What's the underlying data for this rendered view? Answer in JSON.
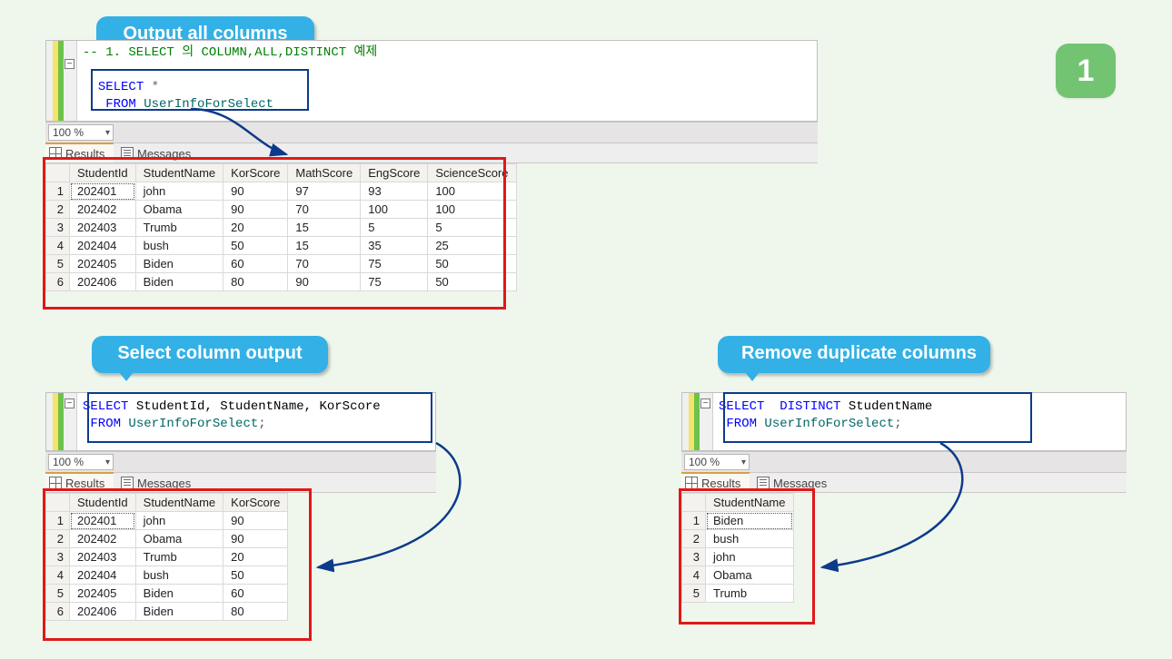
{
  "page_number": "1",
  "callouts": {
    "top": "Output all columns",
    "left": "Select column output",
    "right": "Remove duplicate columns"
  },
  "editor_top": {
    "comment": "-- 1. SELECT 의 COLUMN,ALL,DISTINCT 예제",
    "sql_kw1": "SELECT",
    "sql_star": "*",
    "sql_kw2": "FROM",
    "sql_tbl": "UserInfoForSelect"
  },
  "editor_left": {
    "sql_kw1": "SELECT",
    "sql_cols": "StudentId, StudentName, KorScore",
    "sql_kw2": "FROM",
    "sql_tbl": "UserInfoForSelect",
    "semi": ";"
  },
  "editor_right": {
    "sql_kw1": "SELECT",
    "sql_kw_dist": "DISTINCT",
    "sql_cols": "StudentName",
    "sql_kw2": "FROM",
    "sql_tbl": "UserInfoForSelect",
    "semi": ";"
  },
  "zoom_label": "100 %",
  "tabs": {
    "results": "Results",
    "messages": "Messages"
  },
  "grid_all": {
    "headers": [
      "StudentId",
      "StudentName",
      "KorScore",
      "MathScore",
      "EngScore",
      "ScienceScore"
    ],
    "rows": [
      [
        "1",
        "202401",
        "john",
        "90",
        "97",
        "93",
        "100"
      ],
      [
        "2",
        "202402",
        "Obama",
        "90",
        "70",
        "100",
        "100"
      ],
      [
        "3",
        "202403",
        "Trumb",
        "20",
        "15",
        "5",
        "5"
      ],
      [
        "4",
        "202404",
        "bush",
        "50",
        "15",
        "35",
        "25"
      ],
      [
        "5",
        "202405",
        "Biden",
        "60",
        "70",
        "75",
        "50"
      ],
      [
        "6",
        "202406",
        "Biden",
        "80",
        "90",
        "75",
        "50"
      ]
    ]
  },
  "grid_cols": {
    "headers": [
      "StudentId",
      "StudentName",
      "KorScore"
    ],
    "rows": [
      [
        "1",
        "202401",
        "john",
        "90"
      ],
      [
        "2",
        "202402",
        "Obama",
        "90"
      ],
      [
        "3",
        "202403",
        "Trumb",
        "20"
      ],
      [
        "4",
        "202404",
        "bush",
        "50"
      ],
      [
        "5",
        "202405",
        "Biden",
        "60"
      ],
      [
        "6",
        "202406",
        "Biden",
        "80"
      ]
    ]
  },
  "grid_dist": {
    "headers": [
      "StudentName"
    ],
    "rows": [
      [
        "1",
        "Biden"
      ],
      [
        "2",
        "bush"
      ],
      [
        "3",
        "john"
      ],
      [
        "4",
        "Obama"
      ],
      [
        "5",
        "Trumb"
      ]
    ]
  }
}
